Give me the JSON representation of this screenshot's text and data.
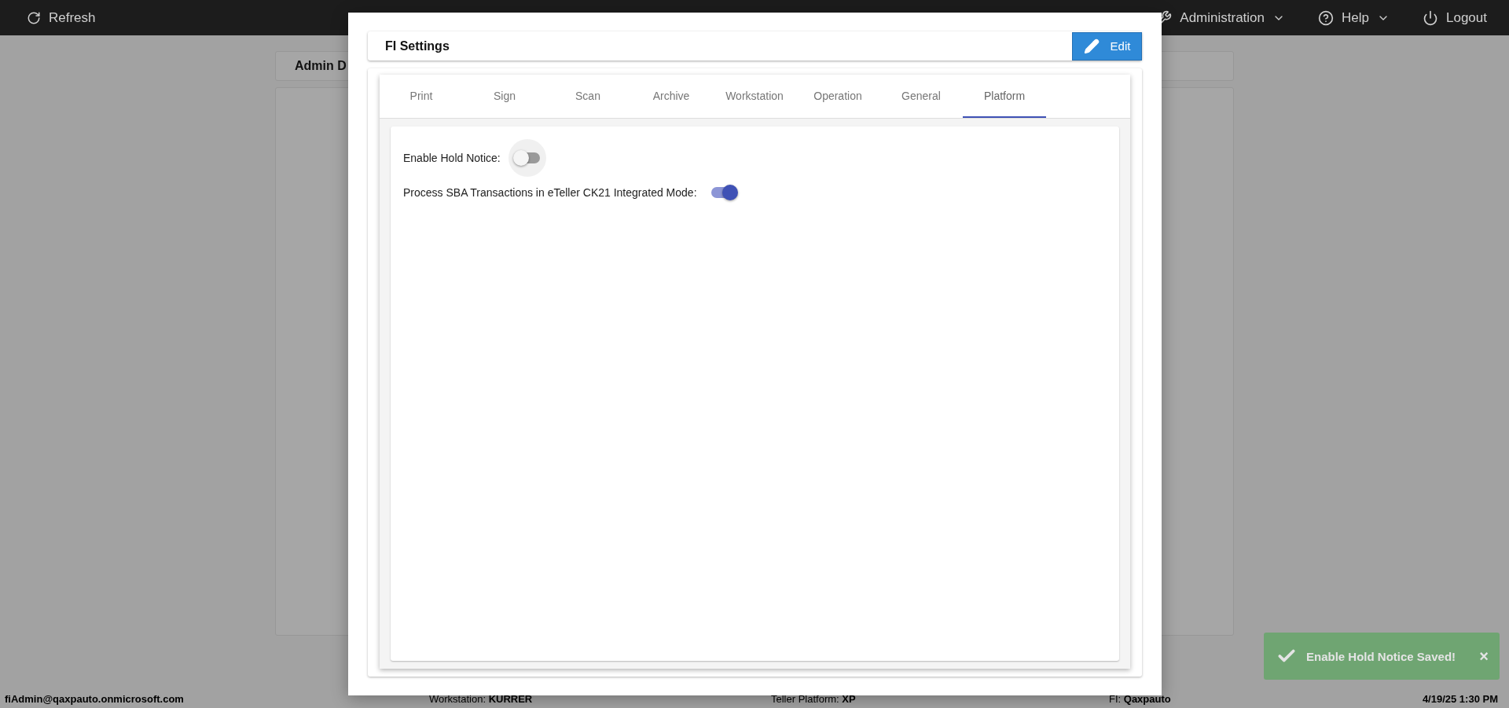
{
  "top_bar": {
    "refresh": "Refresh",
    "menus": [
      {
        "kind": "admin",
        "label": "Administration",
        "dropdown": true
      },
      {
        "kind": "help",
        "label": "Help",
        "dropdown": true
      },
      {
        "kind": "logout",
        "label": "Logout",
        "dropdown": false
      }
    ]
  },
  "background": {
    "card_title": "Admin D"
  },
  "modal": {
    "title": "FI Settings",
    "edit_button": "Edit",
    "tabs": [
      {
        "label": "Print",
        "selected": false
      },
      {
        "label": "Sign",
        "selected": false
      },
      {
        "label": "Scan",
        "selected": false
      },
      {
        "label": "Archive",
        "selected": false
      },
      {
        "label": "Workstation",
        "selected": false
      },
      {
        "label": "Operation",
        "selected": false
      },
      {
        "label": "General",
        "selected": false
      },
      {
        "label": "Platform",
        "selected": true
      }
    ],
    "settings": [
      {
        "label": "Enable Hold Notice:",
        "on": false,
        "focused": true
      },
      {
        "label": "Process SBA Transactions in eTeller CK21 Integrated Mode:",
        "on": true,
        "focused": false
      }
    ]
  },
  "status_bar": [
    {
      "value": "fiAdmin@qaxpauto.onmicrosoft.com"
    },
    {
      "label": "Workstation:",
      "value": "KURRER"
    },
    {
      "label": "Teller Platform:",
      "value": "XP"
    },
    {
      "label": "FI:",
      "value": "Qaxpauto"
    },
    {
      "value": "4/19/25 1:30 PM"
    }
  ],
  "toast": {
    "text": "Enable Hold Notice Saved!",
    "close": "×"
  }
}
